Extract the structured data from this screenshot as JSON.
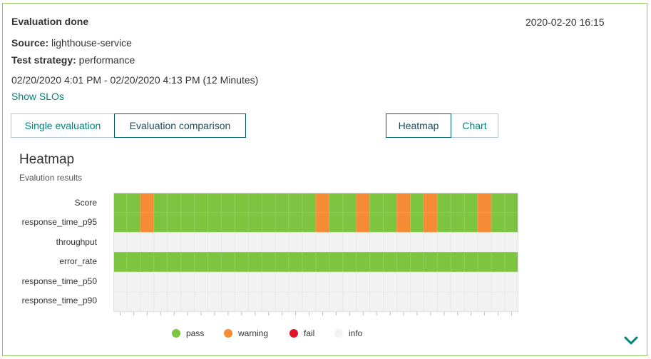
{
  "header": {
    "title": "Evaluation done",
    "timestamp": "2020-02-20 16:15",
    "source_label": "Source:",
    "source_value": " lighthouse-service",
    "strategy_label": "Test strategy:",
    "strategy_value": " performance",
    "time_range": "02/20/2020 4:01 PM - 02/20/2020 4:13 PM (12 Minutes)",
    "show_slos": "Show SLOs"
  },
  "tabs": {
    "single": "Single evaluation",
    "comparison": "Evaluation comparison",
    "active": "comparison"
  },
  "view_toggle": {
    "heatmap": "Heatmap",
    "chart": "Chart",
    "active": "heatmap"
  },
  "chart_data": {
    "type": "heatmap",
    "title": "Heatmap",
    "subtitle": "Evalution results",
    "rows": [
      "Score",
      "response_time_p95",
      "throughput",
      "error_rate",
      "response_time_p50",
      "response_time_p90"
    ],
    "columns": 30,
    "status_colors": {
      "pass": "#7dc540",
      "warning": "#f68b36",
      "fail": "#dc172a",
      "info": "#f2f2f2"
    },
    "values": [
      [
        "pass",
        "pass",
        "warning",
        "pass",
        "pass",
        "pass",
        "pass",
        "pass",
        "pass",
        "pass",
        "pass",
        "pass",
        "pass",
        "pass",
        "pass",
        "warning",
        "pass",
        "pass",
        "warning",
        "pass",
        "pass",
        "warning",
        "pass",
        "warning",
        "pass",
        "pass",
        "pass",
        "warning",
        "pass",
        "pass"
      ],
      [
        "pass",
        "pass",
        "warning",
        "pass",
        "pass",
        "pass",
        "pass",
        "pass",
        "pass",
        "pass",
        "pass",
        "pass",
        "pass",
        "pass",
        "pass",
        "warning",
        "pass",
        "pass",
        "warning",
        "pass",
        "pass",
        "warning",
        "pass",
        "warning",
        "pass",
        "pass",
        "pass",
        "warning",
        "pass",
        "pass"
      ],
      [
        "info",
        "info",
        "info",
        "info",
        "info",
        "info",
        "info",
        "info",
        "info",
        "info",
        "info",
        "info",
        "info",
        "info",
        "info",
        "info",
        "info",
        "info",
        "info",
        "info",
        "info",
        "info",
        "info",
        "info",
        "info",
        "info",
        "info",
        "info",
        "info",
        "info"
      ],
      [
        "pass",
        "pass",
        "pass",
        "pass",
        "pass",
        "pass",
        "pass",
        "pass",
        "pass",
        "pass",
        "pass",
        "pass",
        "pass",
        "pass",
        "pass",
        "pass",
        "pass",
        "pass",
        "pass",
        "pass",
        "pass",
        "pass",
        "pass",
        "pass",
        "pass",
        "pass",
        "pass",
        "pass",
        "pass",
        "pass"
      ],
      [
        "info",
        "info",
        "info",
        "info",
        "info",
        "info",
        "info",
        "info",
        "info",
        "info",
        "info",
        "info",
        "info",
        "info",
        "info",
        "info",
        "info",
        "info",
        "info",
        "info",
        "info",
        "info",
        "info",
        "info",
        "info",
        "info",
        "info",
        "info",
        "info",
        "info"
      ],
      [
        "info",
        "info",
        "info",
        "info",
        "info",
        "info",
        "info",
        "info",
        "info",
        "info",
        "info",
        "info",
        "info",
        "info",
        "info",
        "info",
        "info",
        "info",
        "info",
        "info",
        "info",
        "info",
        "info",
        "info",
        "info",
        "info",
        "info",
        "info",
        "info",
        "info"
      ]
    ],
    "legend": [
      {
        "key": "pass",
        "label": "pass"
      },
      {
        "key": "warning",
        "label": "warning"
      },
      {
        "key": "fail",
        "label": "fail"
      },
      {
        "key": "info",
        "label": "info"
      }
    ]
  },
  "icons": {
    "expand": "chevron-down-icon"
  },
  "colors": {
    "accent": "#00857a",
    "card_border": "#8ec85a"
  }
}
